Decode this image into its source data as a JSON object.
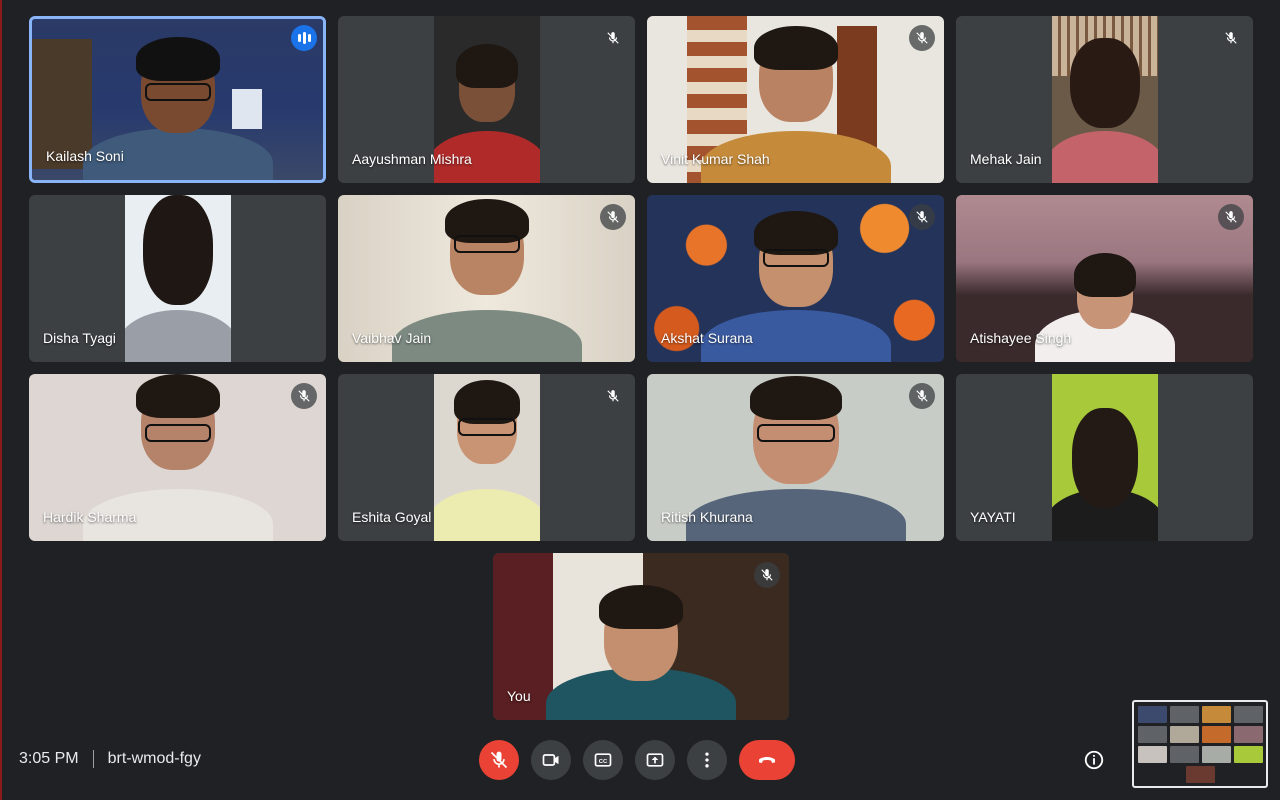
{
  "meeting": {
    "time": "3:05 PM",
    "code": "brt-wmod-fgy"
  },
  "participants": [
    {
      "name": "Kailash Soni",
      "speaking": true,
      "muted": false
    },
    {
      "name": "Aayushman Mishra",
      "muted": true
    },
    {
      "name": "Vinit Kumar Shah",
      "muted": true
    },
    {
      "name": "Mehak Jain",
      "muted": true
    },
    {
      "name": "Disha Tyagi",
      "muted": false
    },
    {
      "name": "Vaibhav Jain",
      "muted": true
    },
    {
      "name": "Akshat Surana",
      "muted": true
    },
    {
      "name": "Atishayee Singh",
      "muted": true
    },
    {
      "name": "Hardik Sharma",
      "muted": true
    },
    {
      "name": "Eshita Goyal",
      "muted": true
    },
    {
      "name": "Ritish Khurana",
      "muted": true
    },
    {
      "name": "YAYATI",
      "muted": false
    },
    {
      "name": "You",
      "muted": true
    }
  ],
  "controls": {
    "mic": "mic-off-icon",
    "camera": "camera-icon",
    "captions": "closed-captions-icon",
    "present": "present-screen-icon",
    "more": "more-options-icon",
    "end": "end-call-icon",
    "info": "info-icon"
  },
  "colors": {
    "background": "#202124",
    "tile": "#3c4043",
    "accent": "#8ab4f8",
    "danger": "#ea4335"
  }
}
